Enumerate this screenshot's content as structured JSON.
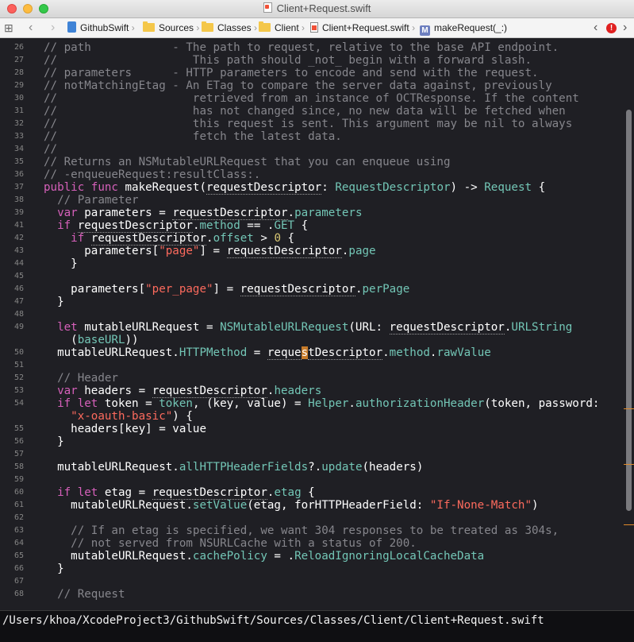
{
  "window": {
    "title": "Client+Request.swift"
  },
  "jumpbar": {
    "crumbs": [
      "GithubSwift",
      "Sources",
      "Classes",
      "Client",
      "Client+Request.swift",
      "makeRequest(_:)"
    ],
    "method_badge": "M",
    "error_badge": "!"
  },
  "editor": {
    "lines": [
      {
        "n": "26",
        "segs": [
          [
            "c",
            "// path            - The path to request, relative to the base API endpoint."
          ]
        ]
      },
      {
        "n": "27",
        "segs": [
          [
            "c",
            "//                    This path should _not_ begin with a forward slash."
          ]
        ]
      },
      {
        "n": "28",
        "segs": [
          [
            "c",
            "// parameters      - HTTP parameters to encode and send with the request."
          ]
        ]
      },
      {
        "n": "29",
        "segs": [
          [
            "c",
            "// notMatchingEtag - An ETag to compare the server data against, previously"
          ]
        ]
      },
      {
        "n": "30",
        "segs": [
          [
            "c",
            "//                    retrieved from an instance of OCTResponse. If the content"
          ]
        ]
      },
      {
        "n": "31",
        "segs": [
          [
            "c",
            "//                    has not changed since, no new data will be fetched when"
          ]
        ]
      },
      {
        "n": "32",
        "segs": [
          [
            "c",
            "//                    this request is sent. This argument may be nil to always"
          ]
        ]
      },
      {
        "n": "33",
        "segs": [
          [
            "c",
            "//                    fetch the latest data."
          ]
        ]
      },
      {
        "n": "34",
        "segs": [
          [
            "c",
            "//"
          ]
        ]
      },
      {
        "n": "35",
        "segs": [
          [
            "c",
            "// Returns an NSMutableURLRequest that you can enqueue using"
          ]
        ]
      },
      {
        "n": "36",
        "segs": [
          [
            "c",
            "// -enqueueRequest:resultClass:."
          ]
        ]
      },
      {
        "n": "37",
        "segs": [
          [
            "k",
            "public func"
          ],
          [
            "p",
            " makeRequest("
          ],
          [
            "u",
            "requestDescriptor"
          ],
          [
            "p",
            ": "
          ],
          [
            "t",
            "RequestDescriptor"
          ],
          [
            "p",
            ") -> "
          ],
          [
            "t",
            "Request"
          ],
          [
            "p",
            " {"
          ]
        ]
      },
      {
        "n": "38",
        "segs": [
          [
            "c",
            "  // Parameter"
          ]
        ]
      },
      {
        "n": "39",
        "segs": [
          [
            "k",
            "  var"
          ],
          [
            "p",
            " parameters = "
          ],
          [
            "u",
            "requestDescriptor"
          ],
          [
            "p",
            "."
          ],
          [
            "t",
            "parameters"
          ]
        ]
      },
      {
        "n": "41",
        "segs": [
          [
            "k",
            "  if"
          ],
          [
            "p",
            " "
          ],
          [
            "u",
            "requestDescriptor"
          ],
          [
            "p",
            "."
          ],
          [
            "t",
            "method"
          ],
          [
            "p",
            " == ."
          ],
          [
            "t",
            "GET"
          ],
          [
            "p",
            " {"
          ]
        ]
      },
      {
        "n": "42",
        "segs": [
          [
            "k",
            "    if"
          ],
          [
            "p",
            " "
          ],
          [
            "u",
            "requestDescriptor"
          ],
          [
            "p",
            "."
          ],
          [
            "t",
            "offset"
          ],
          [
            "p",
            " > "
          ],
          [
            "n",
            "0"
          ],
          [
            "p",
            " {"
          ]
        ]
      },
      {
        "n": "43",
        "segs": [
          [
            "p",
            "      parameters["
          ],
          [
            "s",
            "\"page\""
          ],
          [
            "p",
            "] = "
          ],
          [
            "u",
            "requestDescriptor"
          ],
          [
            "p",
            "."
          ],
          [
            "t",
            "page"
          ]
        ]
      },
      {
        "n": "44",
        "segs": [
          [
            "p",
            "    }"
          ]
        ]
      },
      {
        "n": "45",
        "segs": []
      },
      {
        "n": "46",
        "segs": [
          [
            "p",
            "    parameters["
          ],
          [
            "s",
            "\"per_page\""
          ],
          [
            "p",
            "] = "
          ],
          [
            "u",
            "requestDescriptor"
          ],
          [
            "p",
            "."
          ],
          [
            "t",
            "perPage"
          ]
        ]
      },
      {
        "n": "47",
        "segs": [
          [
            "p",
            "  }"
          ]
        ]
      },
      {
        "n": "48",
        "segs": []
      },
      {
        "n": "49",
        "segs": [
          [
            "k",
            "  let"
          ],
          [
            "p",
            " mutableURLRequest = "
          ],
          [
            "t",
            "NSMutableURLRequest"
          ],
          [
            "p",
            "(URL: "
          ],
          [
            "u",
            "requestDescriptor"
          ],
          [
            "p",
            "."
          ],
          [
            "t",
            "URLString"
          ]
        ]
      },
      {
        "n": "",
        "segs": [
          [
            "p",
            "    ("
          ],
          [
            "t",
            "baseURL"
          ],
          [
            "p",
            "))"
          ]
        ]
      },
      {
        "n": "50",
        "segs": [
          [
            "p",
            "  mutableURLRequest."
          ],
          [
            "t",
            "HTTPMethod"
          ],
          [
            "p",
            " = "
          ],
          [
            "u",
            "reque"
          ],
          [
            "x",
            "s"
          ],
          [
            "u",
            "tDescriptor"
          ],
          [
            "p",
            "."
          ],
          [
            "t",
            "method"
          ],
          [
            "p",
            "."
          ],
          [
            "t",
            "rawValue"
          ]
        ]
      },
      {
        "n": "51",
        "segs": []
      },
      {
        "n": "52",
        "segs": [
          [
            "c",
            "  // Header"
          ]
        ]
      },
      {
        "n": "53",
        "segs": [
          [
            "k",
            "  var"
          ],
          [
            "p",
            " headers = "
          ],
          [
            "u",
            "requestDescriptor"
          ],
          [
            "p",
            "."
          ],
          [
            "t",
            "headers"
          ]
        ]
      },
      {
        "n": "54",
        "segs": [
          [
            "k",
            "  if let"
          ],
          [
            "p",
            " token = "
          ],
          [
            "t",
            "token"
          ],
          [
            "p",
            ", (key, value) = "
          ],
          [
            "t",
            "Helper"
          ],
          [
            "p",
            "."
          ],
          [
            "t",
            "authorizationHeader"
          ],
          [
            "p",
            "(token, password:"
          ]
        ]
      },
      {
        "n": "",
        "segs": [
          [
            "s",
            "    \"x-oauth-basic\""
          ],
          [
            "p",
            ") {"
          ]
        ]
      },
      {
        "n": "55",
        "segs": [
          [
            "p",
            "    headers[key] = value"
          ]
        ]
      },
      {
        "n": "56",
        "segs": [
          [
            "p",
            "  }"
          ]
        ]
      },
      {
        "n": "57",
        "segs": []
      },
      {
        "n": "58",
        "segs": [
          [
            "p",
            "  mutableURLRequest."
          ],
          [
            "t",
            "allHTTPHeaderFields"
          ],
          [
            "p",
            "?."
          ],
          [
            "t",
            "update"
          ],
          [
            "p",
            "(headers)"
          ]
        ]
      },
      {
        "n": "59",
        "segs": []
      },
      {
        "n": "60",
        "segs": [
          [
            "k",
            "  if let"
          ],
          [
            "p",
            " etag = "
          ],
          [
            "u",
            "requestDescriptor"
          ],
          [
            "p",
            "."
          ],
          [
            "t",
            "etag"
          ],
          [
            "p",
            " {"
          ]
        ]
      },
      {
        "n": "61",
        "segs": [
          [
            "p",
            "    mutableURLRequest."
          ],
          [
            "t",
            "setValue"
          ],
          [
            "p",
            "(etag, forHTTPHeaderField: "
          ],
          [
            "s",
            "\"If-None-Match\""
          ],
          [
            "p",
            ")"
          ]
        ]
      },
      {
        "n": "62",
        "segs": []
      },
      {
        "n": "63",
        "segs": [
          [
            "c",
            "    // If an etag is specified, we want 304 responses to be treated as 304s,"
          ]
        ]
      },
      {
        "n": "64",
        "segs": [
          [
            "c",
            "    // not served from NSURLCache with a status of 200."
          ]
        ]
      },
      {
        "n": "65",
        "segs": [
          [
            "p",
            "    mutableURLRequest."
          ],
          [
            "t",
            "cachePolicy"
          ],
          [
            "p",
            " = ."
          ],
          [
            "t",
            "ReloadIgnoringLocalCacheData"
          ]
        ]
      },
      {
        "n": "66",
        "segs": [
          [
            "p",
            "  }"
          ]
        ]
      },
      {
        "n": "67",
        "segs": []
      },
      {
        "n": "68",
        "segs": [
          [
            "c",
            "  // Request"
          ]
        ]
      }
    ]
  },
  "statusbar": {
    "path": "/Users/khoa/XcodeProject3/GithubSwift/Sources/Classes/Client/Client+Request.swift"
  }
}
